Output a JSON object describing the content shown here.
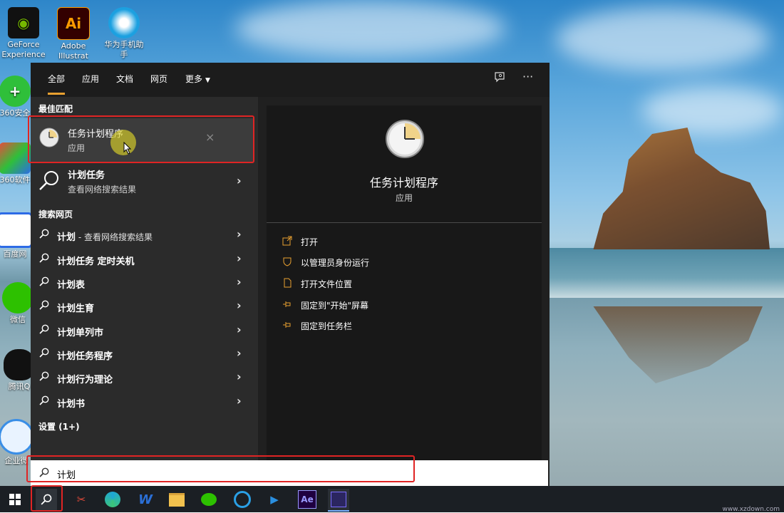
{
  "desktop": {
    "icons": [
      {
        "label": "GeForce Experience",
        "glyph": "",
        "color": "#76b900"
      },
      {
        "label": "Adobe Illustrat",
        "glyph": "Ai",
        "color": "#ff9a00"
      },
      {
        "label": "华为手机助手",
        "glyph": "",
        "color": "#1ca0e0"
      },
      {
        "label": "360安全",
        "glyph": "+",
        "color": "#2fbf3a"
      },
      {
        "label": "360软件",
        "glyph": "",
        "color": "#e84c3d"
      },
      {
        "label": "百度网",
        "glyph": "",
        "color": "#2d6be6"
      },
      {
        "label": "微信",
        "glyph": "",
        "color": "#2dc100"
      },
      {
        "label": "腾讯Q",
        "glyph": "",
        "color": "#111111"
      },
      {
        "label": "企业微",
        "glyph": "",
        "color": "#3a8ee6"
      }
    ]
  },
  "tabs": [
    {
      "label": "全部",
      "active": true
    },
    {
      "label": "应用"
    },
    {
      "label": "文档"
    },
    {
      "label": "网页"
    },
    {
      "label": "更多"
    }
  ],
  "top_icons": [
    "feedback-icon",
    "more-options-icon"
  ],
  "top_more_glyph": "···",
  "left": {
    "best_match_heading": "最佳匹配",
    "best_match": {
      "title": "任务计划程序",
      "subtitle": "应用",
      "close_glyph": "×"
    },
    "web_result": {
      "title": "计划任务",
      "subtitle": "查看网络搜索结果"
    },
    "search_web_heading": "搜索网页",
    "web_items": [
      {
        "bold": "计划",
        "light": " - 查看网络搜索结果"
      },
      {
        "bold": "计划任务 定时关机",
        "light": ""
      },
      {
        "bold": "计划表",
        "light": ""
      },
      {
        "bold": "计划生育",
        "light": ""
      },
      {
        "bold": "计划单列市",
        "light": ""
      },
      {
        "bold": "计划任务程序",
        "light": ""
      },
      {
        "bold": "计划行为理论",
        "light": ""
      },
      {
        "bold": "计划书",
        "light": ""
      }
    ],
    "settings_heading": "设置 (1+)"
  },
  "right": {
    "title": "任务计划程序",
    "subtitle": "应用",
    "actions": [
      {
        "label": "打开",
        "icon": "open-icon"
      },
      {
        "label": "以管理员身份运行",
        "icon": "shield-icon"
      },
      {
        "label": "打开文件位置",
        "icon": "file-location-icon"
      },
      {
        "label": "固定到\"开始\"屏幕",
        "icon": "pin-icon"
      },
      {
        "label": "固定到任务栏",
        "icon": "pin-icon"
      }
    ]
  },
  "search": {
    "value": "计划"
  },
  "taskbar": {
    "items": [
      {
        "name": "windows-start",
        "glyph": ""
      },
      {
        "name": "search",
        "glyph": ""
      },
      {
        "name": "snipping-app",
        "glyph": "✂",
        "color": "#e04a3a"
      },
      {
        "name": "edge",
        "glyph": "e",
        "color": "#1ea6d6"
      },
      {
        "name": "wps-writer",
        "glyph": "W",
        "color": "#2b6fd6"
      },
      {
        "name": "file-explorer",
        "glyph": "",
        "color": "#f2c14e"
      },
      {
        "name": "wechat",
        "glyph": "",
        "color": "#2dc100"
      },
      {
        "name": "browser",
        "glyph": "",
        "color": "#2aa0e6"
      },
      {
        "name": "video-editor",
        "glyph": "▶",
        "color": "#2a8fe0"
      },
      {
        "name": "after-effects",
        "glyph": "Ae",
        "color": "#9999ff"
      },
      {
        "name": "active-app",
        "glyph": "",
        "color": "#7a6cff"
      }
    ]
  },
  "watermark": "www.xzdown.com"
}
